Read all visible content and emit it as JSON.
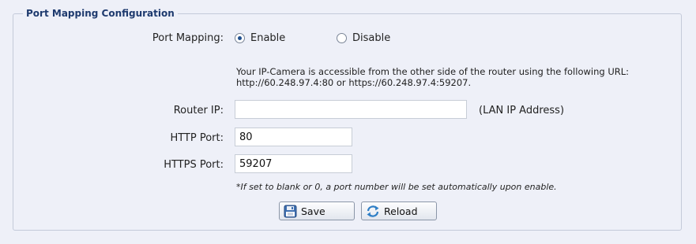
{
  "section": {
    "legend": "Port Mapping Configuration"
  },
  "port_mapping": {
    "label": "Port Mapping:",
    "options": [
      {
        "label": "Enable",
        "checked": true
      },
      {
        "label": "Disable",
        "checked": false
      }
    ],
    "info_line1": "Your IP-Camera is accessible from the other side of the router using the following URL:",
    "info_line2": "http://60.248.97.4:80 or https://60.248.97.4:59207."
  },
  "router_ip": {
    "label": "Router IP:",
    "value": "",
    "suffix": "(LAN IP Address)"
  },
  "http_port": {
    "label": "HTTP Port:",
    "value": "80"
  },
  "https_port": {
    "label": "HTTPS Port:",
    "value": "59207"
  },
  "hint": "*If set to blank or 0, a port number will be set automatically upon enable.",
  "buttons": {
    "save": {
      "label": "Save",
      "icon": "floppy-disk-icon"
    },
    "reload": {
      "label": "Reload",
      "icon": "reload-icon"
    }
  },
  "colors": {
    "panel_bg": "#eef0f8",
    "legend_text": "#1e3a6e",
    "border": "#c4cad9"
  }
}
